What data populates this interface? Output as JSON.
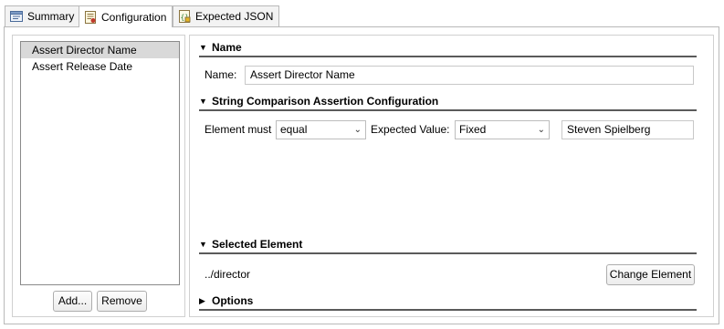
{
  "tabs": [
    {
      "label": "Summary",
      "icon": "summary-icon",
      "active": false
    },
    {
      "label": "Configuration",
      "icon": "configuration-icon",
      "active": true
    },
    {
      "label": "Expected JSON",
      "icon": "json-icon",
      "active": false
    }
  ],
  "assertions": {
    "items": [
      "Assert Director Name",
      "Assert Release Date"
    ],
    "selected_index": 0,
    "add_label": "Add...",
    "remove_label": "Remove"
  },
  "name_section": {
    "header": "Name",
    "name_label": "Name:",
    "name_value": "Assert Director Name"
  },
  "string_section": {
    "header": "String Comparison Assertion Configuration",
    "element_must_label": "Element must",
    "element_must_value": "equal",
    "expected_value_label": "Expected Value:",
    "expected_mode_value": "Fixed",
    "expected_text_value": "Steven Spielberg"
  },
  "selected_section": {
    "header": "Selected Element",
    "path": "../director",
    "change_label": "Change Element"
  },
  "options_section": {
    "header": "Options"
  },
  "colors": {
    "selection": "#d9d9d9",
    "section_line": "#5a5a5a",
    "border": "#b9b9b9"
  }
}
